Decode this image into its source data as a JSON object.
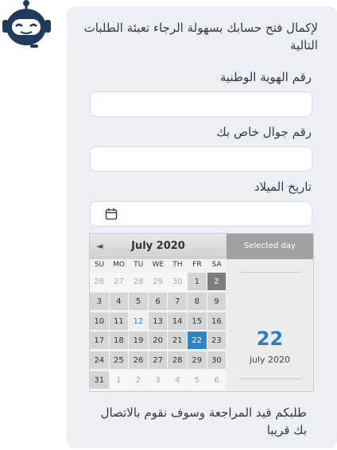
{
  "bot": {
    "icon": "robot-avatar-icon"
  },
  "intro_text": "لإكمال فتح حسابك بسهولة الرجاء تعبئة الطلبات التالية",
  "fields": [
    {
      "label": "رقم الهوية الوطنية",
      "value": ""
    },
    {
      "label": "رقم جوال خاص بك",
      "value": ""
    },
    {
      "label": "تاريخ الميلاد",
      "value": "",
      "icon": "calendar-icon"
    }
  ],
  "calendar": {
    "month_label": "July 2020",
    "prev": "◄",
    "next": "►",
    "weekdays": [
      "SU",
      "MO",
      "TU",
      "WE",
      "TH",
      "FR",
      "SA"
    ],
    "weeks": [
      [
        "26",
        "27",
        "28",
        "29",
        "30",
        "1",
        "2"
      ],
      [
        "3",
        "4",
        "5",
        "6",
        "7",
        "8",
        "9"
      ],
      [
        "10",
        "11",
        "12",
        "13",
        "14",
        "15",
        "16"
      ],
      [
        "17",
        "18",
        "19",
        "20",
        "21",
        "22",
        "23"
      ],
      [
        "24",
        "25",
        "26",
        "27",
        "28",
        "29",
        "30"
      ],
      [
        "31",
        "1",
        "2",
        "3",
        "4",
        "5",
        "6"
      ]
    ],
    "selected_header": "Selected day",
    "selected_day": "22",
    "selected_month_year": "july 2020",
    "colors": {
      "selected": "#2c85c9",
      "accent": "#2a7fc4"
    }
  },
  "outro_text": "طلبكم قيد المراجعة وسوف نقوم بالاتصال بك قريبا"
}
